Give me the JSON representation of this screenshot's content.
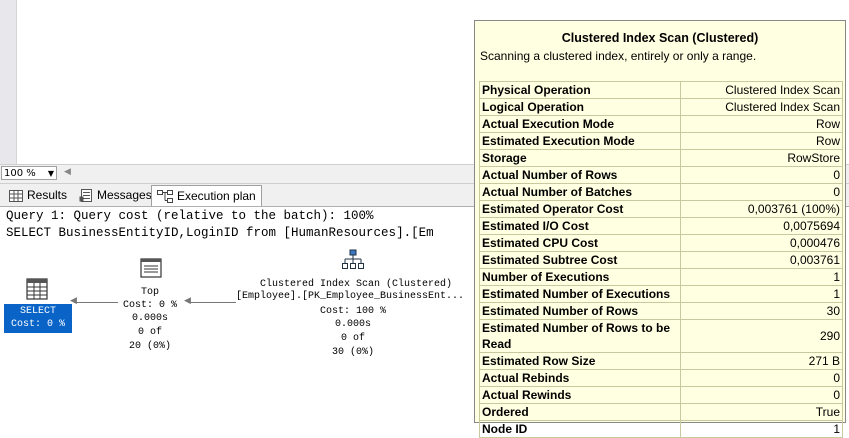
{
  "zoom": {
    "value": "100 %"
  },
  "tabs": [
    {
      "label": "Results",
      "icon": "grid-icon"
    },
    {
      "label": "Messages",
      "icon": "messages-icon"
    },
    {
      "label": "Execution plan",
      "icon": "execution-plan-icon"
    }
  ],
  "query": {
    "line1": "Query 1: Query cost (relative to the batch): 100%",
    "line2": "SELECT BusinessEntityID,LoginID from [HumanResources].[Em"
  },
  "nodes": {
    "select": {
      "name": "SELECT",
      "cost": "Cost: 0 %"
    },
    "top": {
      "name": "Top",
      "cost": "Cost: 0 %",
      "time": "0.000s",
      "of": "0 of",
      "rows": "20 (0%)"
    },
    "scan": {
      "name": "Clustered Index Scan (Clustered)",
      "object": "[Employee].[PK_Employee_BusinessEnt...",
      "cost": "Cost: 100 %",
      "time": "0.000s",
      "of": "0 of",
      "rows": "30 (0%)"
    }
  },
  "tooltip": {
    "title": "Clustered Index Scan (Clustered)",
    "description": "Scanning a clustered index, entirely or only a range.",
    "rows": [
      {
        "key": "Physical Operation",
        "value": "Clustered Index Scan"
      },
      {
        "key": "Logical Operation",
        "value": "Clustered Index Scan"
      },
      {
        "key": "Actual Execution Mode",
        "value": "Row"
      },
      {
        "key": "Estimated Execution Mode",
        "value": "Row"
      },
      {
        "key": "Storage",
        "value": "RowStore"
      },
      {
        "key": "Actual Number of Rows",
        "value": "0"
      },
      {
        "key": "Actual Number of Batches",
        "value": "0"
      },
      {
        "key": "Estimated Operator Cost",
        "value": "0,003761 (100%)"
      },
      {
        "key": "Estimated I/O Cost",
        "value": "0,0075694"
      },
      {
        "key": "Estimated CPU Cost",
        "value": "0,000476"
      },
      {
        "key": "Estimated Subtree Cost",
        "value": "0,003761"
      },
      {
        "key": "Number of Executions",
        "value": "1"
      },
      {
        "key": "Estimated Number of Executions",
        "value": "1"
      },
      {
        "key": "Estimated Number of Rows",
        "value": "30"
      },
      {
        "key": "Estimated Number of Rows to be Read",
        "value": "290"
      },
      {
        "key": "Estimated Row Size",
        "value": "271 B"
      },
      {
        "key": "Actual Rebinds",
        "value": "0"
      },
      {
        "key": "Actual Rewinds",
        "value": "0"
      },
      {
        "key": "Ordered",
        "value": "True"
      },
      {
        "key": "Node ID",
        "value": "1"
      }
    ]
  }
}
